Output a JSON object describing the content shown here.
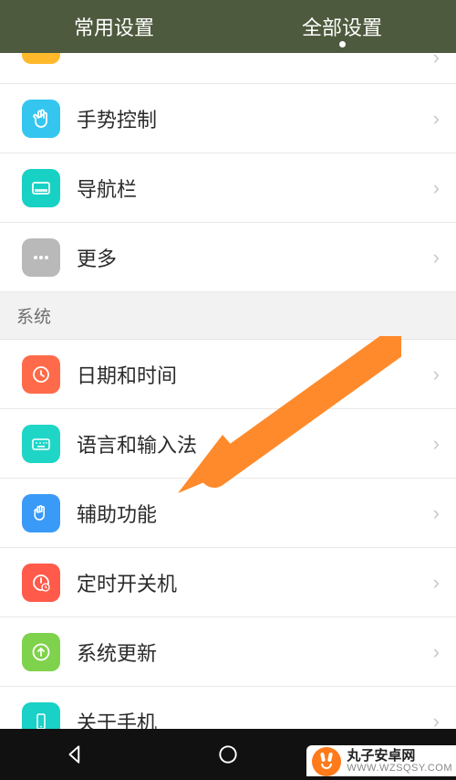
{
  "tabs": {
    "common": "常用设置",
    "all": "全部设置"
  },
  "sections": {
    "system_header": "系统"
  },
  "rows": {
    "gesture": {
      "label": "手势控制",
      "icon_bg": "#34c6ef",
      "icon": "hand"
    },
    "navbar": {
      "label": "导航栏",
      "icon_bg": "#17d1c4",
      "icon": "dock"
    },
    "more": {
      "label": "更多",
      "icon_bg": "#b9b9b9",
      "icon": "dots"
    },
    "datetime": {
      "label": "日期和时间",
      "icon_bg": "#ff6b4a",
      "icon": "clock"
    },
    "language": {
      "label": "语言和输入法",
      "icon_bg": "#1fd6c6",
      "icon": "keyboard"
    },
    "accessibility": {
      "label": "辅助功能",
      "icon_bg": "#3a9af7",
      "icon": "palm"
    },
    "scheduled": {
      "label": "定时开关机",
      "icon_bg": "#ff5a4a",
      "icon": "power"
    },
    "update": {
      "label": "系统更新",
      "icon_bg": "#7fd24b",
      "icon": "arrowup"
    },
    "about": {
      "label": "关于手机",
      "icon_bg": "#19d1c6",
      "icon": "phone"
    }
  },
  "watermark": {
    "title": "丸子安卓网",
    "sub": "WWW.WZSQSY.COM"
  },
  "annotation": {
    "arrow_color": "#ff8a2b"
  }
}
